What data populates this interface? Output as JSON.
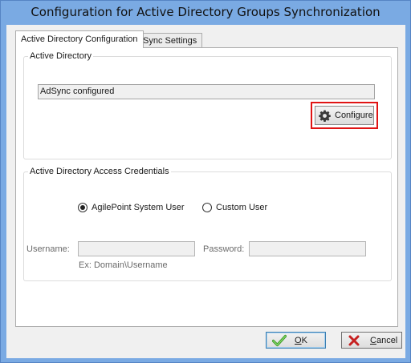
{
  "window": {
    "title": "Configuration for Active Directory Groups Synchronization"
  },
  "tabs": [
    {
      "label": "Active Directory Configuration",
      "active": true
    },
    {
      "label": "Sync Settings",
      "active": false
    }
  ],
  "active_directory": {
    "legend": "Active Directory",
    "status_text": "AdSync configured",
    "configure_label": "Configure",
    "configure_icon": "gear-icon"
  },
  "credentials": {
    "legend": "Active Directory Access Credentials",
    "options": [
      {
        "label": "AgilePoint System User",
        "selected": true
      },
      {
        "label": "Custom User",
        "selected": false
      }
    ],
    "username_label": "Username:",
    "username_value": "",
    "password_label": "Password:",
    "password_value": "",
    "username_hint": "Ex: Domain\\Username"
  },
  "buttons": {
    "ok_label": "OK",
    "ok_icon": "checkmark-icon",
    "cancel_label": "Cancel",
    "cancel_icon": "x-icon"
  },
  "colors": {
    "highlight": "#e01414",
    "title_bar": "#7aaae3"
  }
}
